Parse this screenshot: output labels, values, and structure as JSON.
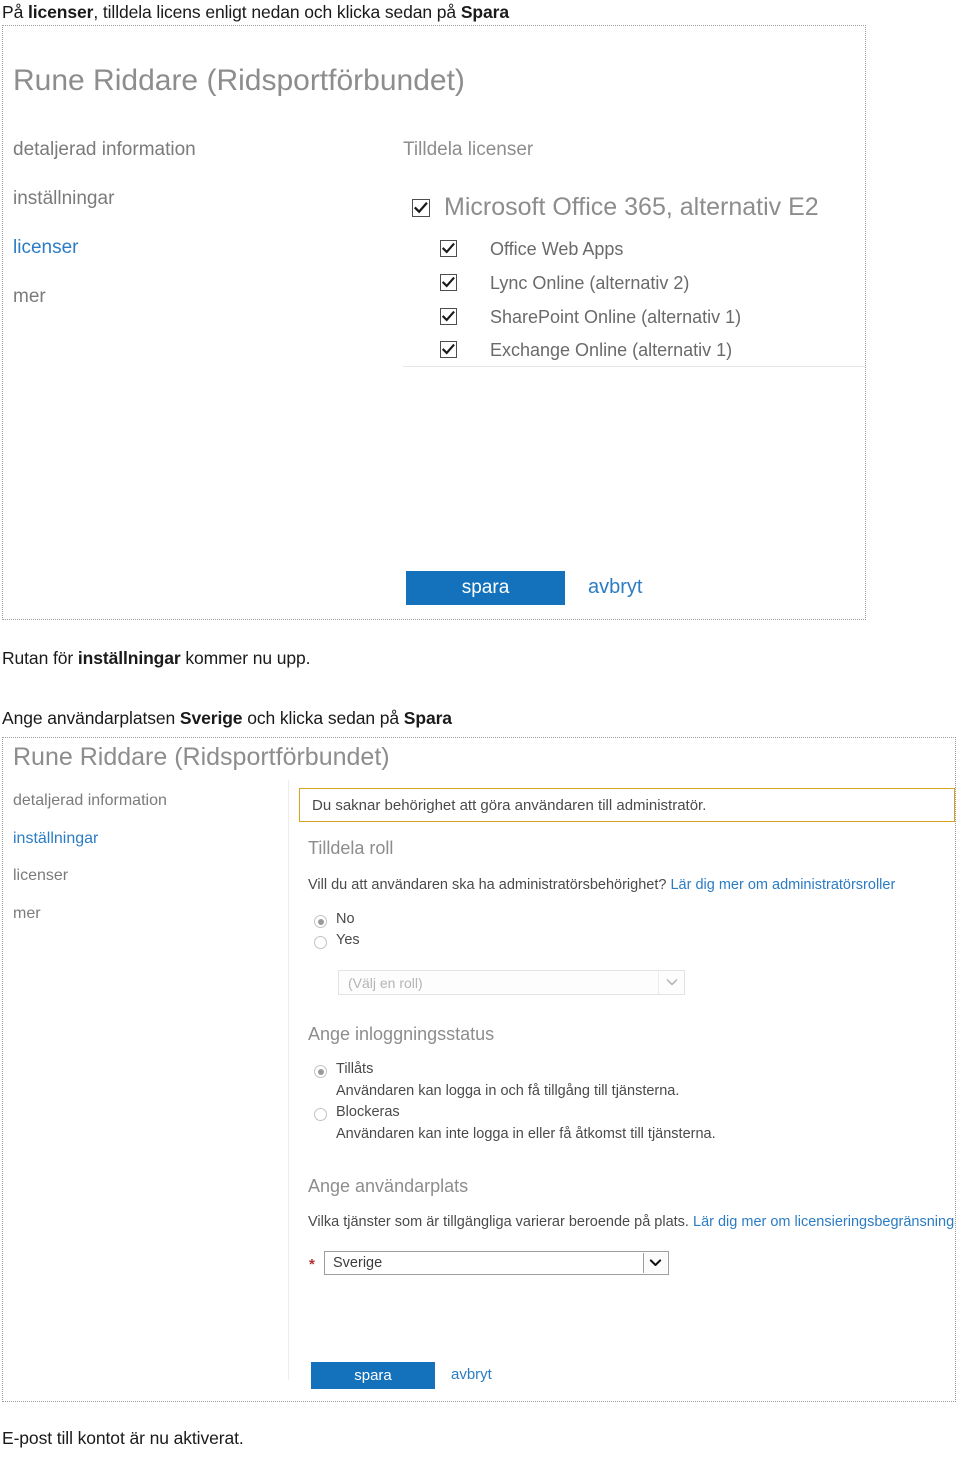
{
  "document": {
    "intro_line": {
      "prefix": "På ",
      "bold1": "licenser",
      "mid": ", tilldela licens enligt nedan och klicka sedan på ",
      "bold2": "Spara"
    },
    "between_line": {
      "prefix": "Rutan för ",
      "bold1": "inställningar",
      "suffix": " kommer nu upp."
    },
    "second_intro_line": {
      "prefix": "Ange användarplatsen ",
      "bold1": "Sverige",
      "mid": " och klicka sedan på ",
      "bold2": "Spara"
    },
    "closing_line": "E-post till kontot är nu aktiverat."
  },
  "screenshot_licenses": {
    "user_title": "Rune Riddare (Ridsportförbundet)",
    "nav": [
      {
        "label": "detaljerad information",
        "active": false
      },
      {
        "label": "inställningar",
        "active": false
      },
      {
        "label": "licenser",
        "active": true
      },
      {
        "label": "mer",
        "active": false
      }
    ],
    "panel_heading": "Tilldela licenser",
    "plan": {
      "label": "Microsoft Office 365, alternativ E2",
      "checked": true
    },
    "services": [
      {
        "label": "Office Web Apps",
        "checked": true
      },
      {
        "label": "Lync Online (alternativ 2)",
        "checked": true
      },
      {
        "label": "SharePoint Online (alternativ 1)",
        "checked": true
      },
      {
        "label": "Exchange Online (alternativ 1)",
        "checked": true
      }
    ],
    "save_label": "spara",
    "cancel_label": "avbryt"
  },
  "screenshot_settings": {
    "user_title": "Rune Riddare (Ridsportförbundet)",
    "nav": [
      {
        "label": "detaljerad information",
        "active": false
      },
      {
        "label": "inställningar",
        "active": true
      },
      {
        "label": "licenser",
        "active": false
      },
      {
        "label": "mer",
        "active": false
      }
    ],
    "notice": "Du saknar behörighet att göra användaren till administratör.",
    "role_section": {
      "heading": "Tilldela roll",
      "question": "Vill du att användaren ska ha administratörsbehörighet? ",
      "link": "Lär dig mer om administratörsroller",
      "options": [
        {
          "label": "No",
          "selected": true
        },
        {
          "label": "Yes",
          "selected": false
        }
      ],
      "role_select_placeholder": "(Välj en roll)"
    },
    "signin_section": {
      "heading": "Ange inloggningsstatus",
      "options": [
        {
          "label": "Tillåts",
          "description": "Användaren kan logga in och få tillgång till tjänsterna.",
          "selected": true
        },
        {
          "label": "Blockeras",
          "description": "Användaren kan inte logga in eller få åtkomst till tjänsterna.",
          "selected": false
        }
      ]
    },
    "location_section": {
      "heading": "Ange användarplats",
      "description": "Vilka tjänster som är tillgängliga varierar beroende på plats. ",
      "link": "Lär dig mer om licensieringsbegränsningar",
      "required_marker": "*",
      "selected_value": "Sverige"
    },
    "save_label": "spara",
    "cancel_label": "avbryt"
  }
}
